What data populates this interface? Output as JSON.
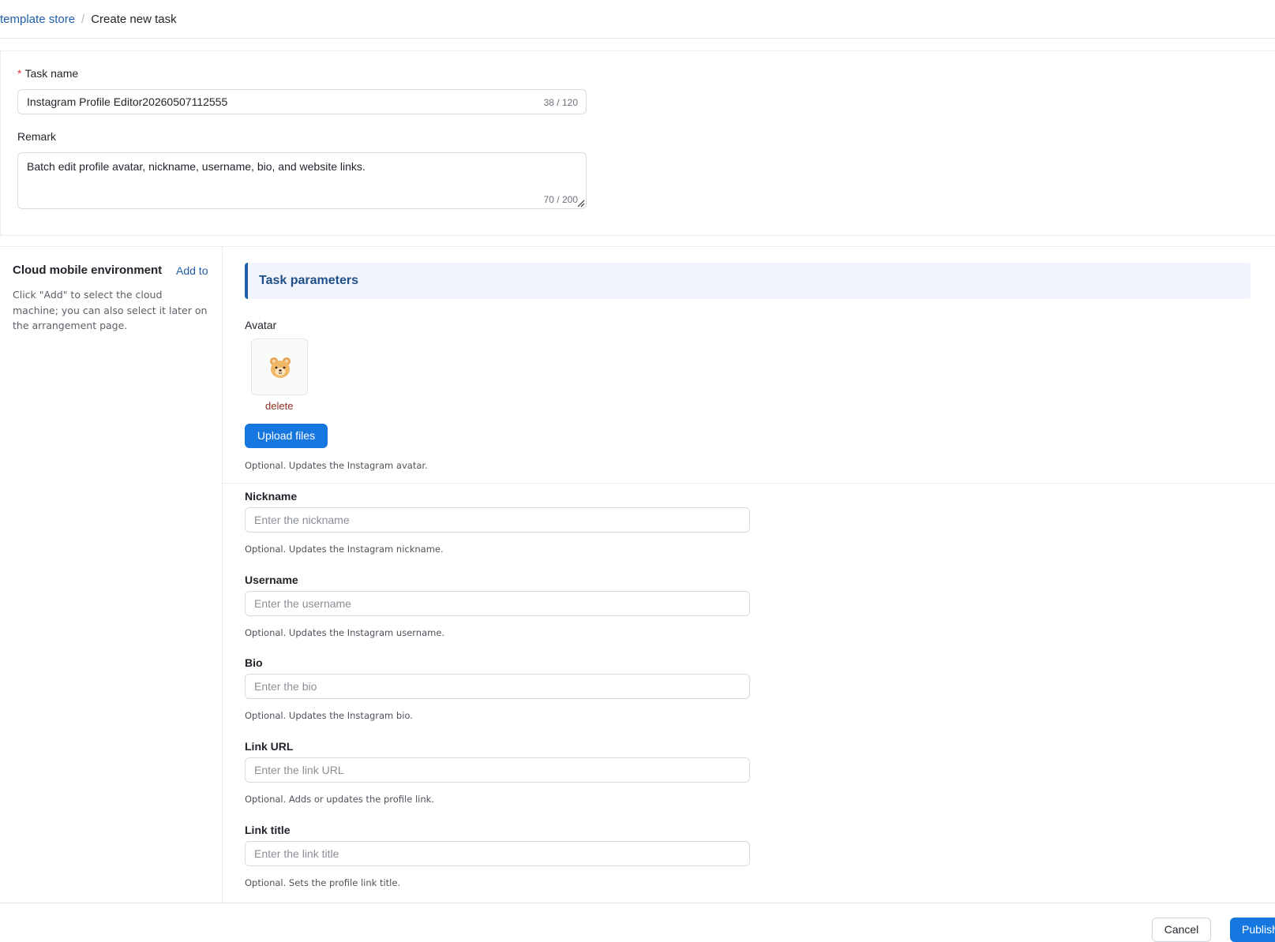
{
  "breadcrumb": {
    "parent": "template store",
    "separator": "/",
    "current": "Create new task"
  },
  "task_form": {
    "task_name_required_mark": "*",
    "task_name_label": "Task name",
    "task_name_value": "Instagram Profile Editor20260507112555",
    "task_name_counter": "38 / 120",
    "remark_label": "Remark",
    "remark_value": "Batch edit profile avatar, nickname, username, bio, and website links.",
    "remark_counter": "70 / 200"
  },
  "sidebar": {
    "title": "Cloud mobile environment",
    "add_label": "Add to",
    "description": "Click \"Add\" to select the cloud machine; you can also select it later on the arrangement page."
  },
  "params": {
    "header": "Task parameters",
    "avatar": {
      "label": "Avatar",
      "delete_label": "delete",
      "upload_label": "Upload files",
      "hint": "Optional. Updates the Instagram avatar."
    },
    "nickname": {
      "label": "Nickname",
      "placeholder": "Enter the nickname",
      "hint": "Optional. Updates the Instagram nickname."
    },
    "username": {
      "label": "Username",
      "placeholder": "Enter the username",
      "hint": "Optional. Updates the Instagram username."
    },
    "bio": {
      "label": "Bio",
      "placeholder": "Enter the bio",
      "hint": "Optional. Updates the Instagram bio."
    },
    "link_url": {
      "label": "Link URL",
      "placeholder": "Enter the link URL",
      "hint": "Optional. Adds or updates the profile link."
    },
    "link_title": {
      "label": "Link title",
      "placeholder": "Enter the link title",
      "hint": "Optional. Sets the profile link title."
    }
  },
  "footer": {
    "cancel_label": "Cancel",
    "publish_label": "Publish"
  },
  "colors": {
    "primary": "#1677e0",
    "link": "#1f5fa8",
    "required": "#e0393e",
    "delete": "#8a2e1e"
  },
  "icons": {
    "avatar_image": "bear-face-icon",
    "textarea_resize": "resize-handle-icon"
  }
}
